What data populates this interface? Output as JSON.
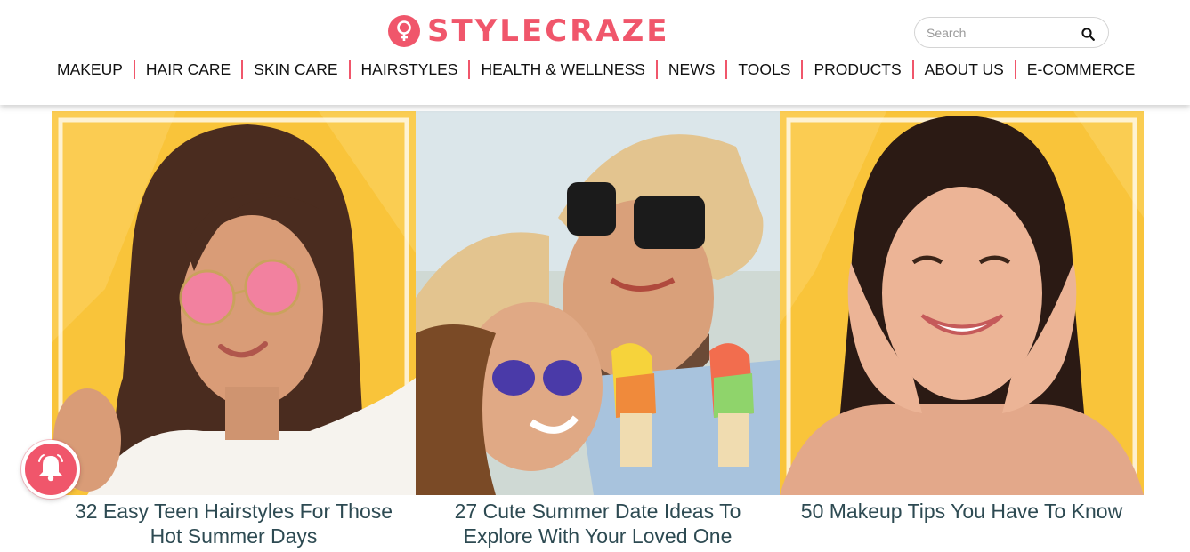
{
  "brand": {
    "name": "STYLECRAZE",
    "accent_color": "#f0566b",
    "logo_icon": "venus-symbol-icon"
  },
  "search": {
    "placeholder": "Search",
    "value": "",
    "icon": "search-icon"
  },
  "nav": {
    "items": [
      {
        "label": "MAKEUP"
      },
      {
        "label": "HAIR CARE"
      },
      {
        "label": "SKIN CARE"
      },
      {
        "label": "HAIRSTYLES"
      },
      {
        "label": "HEALTH & WELLNESS"
      },
      {
        "label": "NEWS"
      },
      {
        "label": "TOOLS"
      },
      {
        "label": "PRODUCTS"
      },
      {
        "label": "ABOUT US"
      },
      {
        "label": "E-COMMERCE"
      }
    ]
  },
  "articles": [
    {
      "title_line1": "32 Easy Teen Hairstyles For Those",
      "title_line2": "Hot Summer Days",
      "image": "woman-pink-sunglasses-photo"
    },
    {
      "title_line1": "27 Cute Summer Date Ideas To",
      "title_line2": "Explore With Your Loved One",
      "image": "couple-ice-cream-photo"
    },
    {
      "title_line1": "50 Makeup Tips You Have To Know",
      "title_line2": "",
      "image": "smiling-woman-photo"
    }
  ],
  "notification": {
    "icon": "bell-icon"
  },
  "colors": {
    "title_text": "#2d4a52",
    "card_background": "#f9c43a"
  }
}
